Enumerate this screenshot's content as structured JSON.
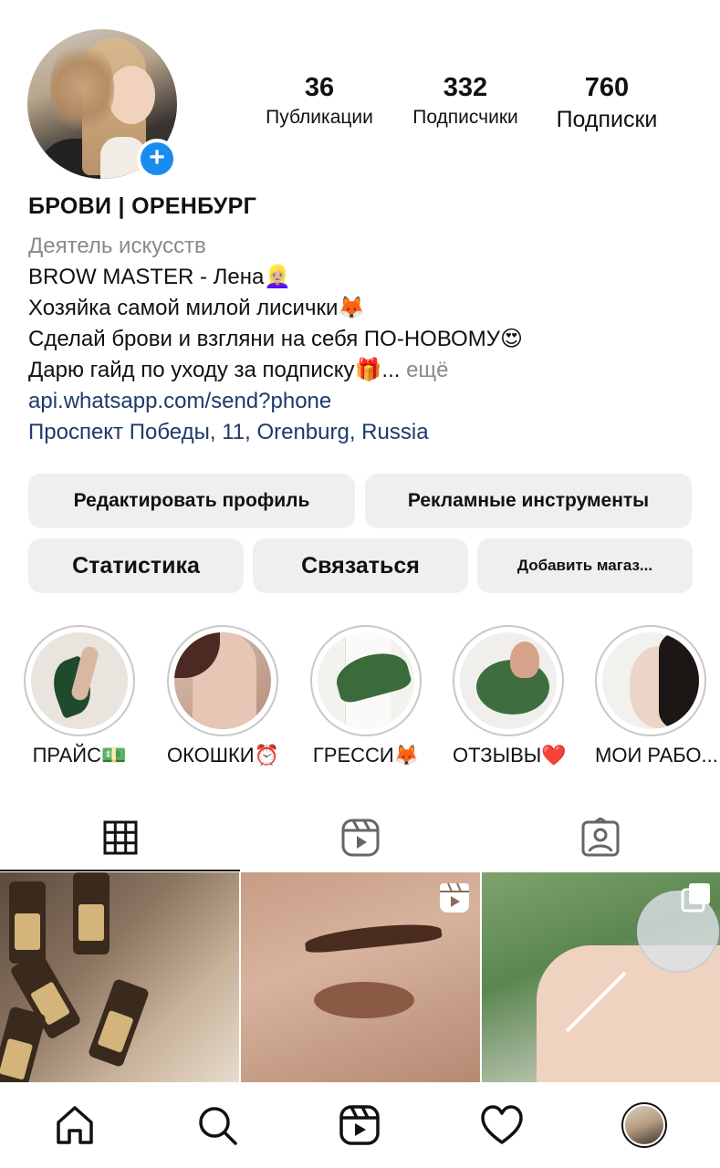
{
  "header": {
    "stats": [
      {
        "count": "36",
        "label": "Публикации"
      },
      {
        "count": "332",
        "label": "Подписчики"
      },
      {
        "count": "760",
        "label": "Подписки"
      }
    ],
    "add_story_symbol": "+"
  },
  "bio": {
    "name": "БРОВИ | ОРЕНБУРГ",
    "category": "Деятель искусств",
    "lines": [
      "BROW MASTER - Лена👱🏼‍♀️",
      "Хозяйка самой милой лисички🦊",
      "Сделай брови и взгляни на себя ПО-НОВОМУ😍",
      "Дарю гайд по уходу за подписку🎁..."
    ],
    "more": "ещё",
    "link": "api.whatsapp.com/send?phone",
    "address": "Проспект Победы, 11, Orenburg, Russia"
  },
  "buttons": {
    "edit_profile": "Редактировать профиль",
    "ad_tools": "Рекламные инструменты",
    "statistics": "Статистика",
    "contact": "Связаться",
    "add_shop": "Добавить магаз..."
  },
  "highlights": [
    {
      "label": "ПРАЙС💵"
    },
    {
      "label": "ОКОШКИ⏰"
    },
    {
      "label": "ГРЕССИ🦊"
    },
    {
      "label": "ОТЗЫВЫ❤️"
    },
    {
      "label": "МОИ РАБО..."
    }
  ],
  "tabs": {
    "active": "grid",
    "icons": [
      "grid-icon",
      "reels-icon",
      "tagged-icon"
    ]
  },
  "grid_posts": [
    {
      "icon": null
    },
    {
      "icon": "reel-badge-icon"
    },
    {
      "icon": "multi-post-icon"
    }
  ],
  "bottom_nav": {
    "icons": [
      "home-icon",
      "search-icon",
      "reels-icon",
      "heart-icon",
      "profile-avatar"
    ]
  },
  "colors": {
    "accent": "#1a8cf0",
    "link": "#1d3a6a",
    "muted": "#8a8a8a",
    "button_bg": "#efefef"
  }
}
